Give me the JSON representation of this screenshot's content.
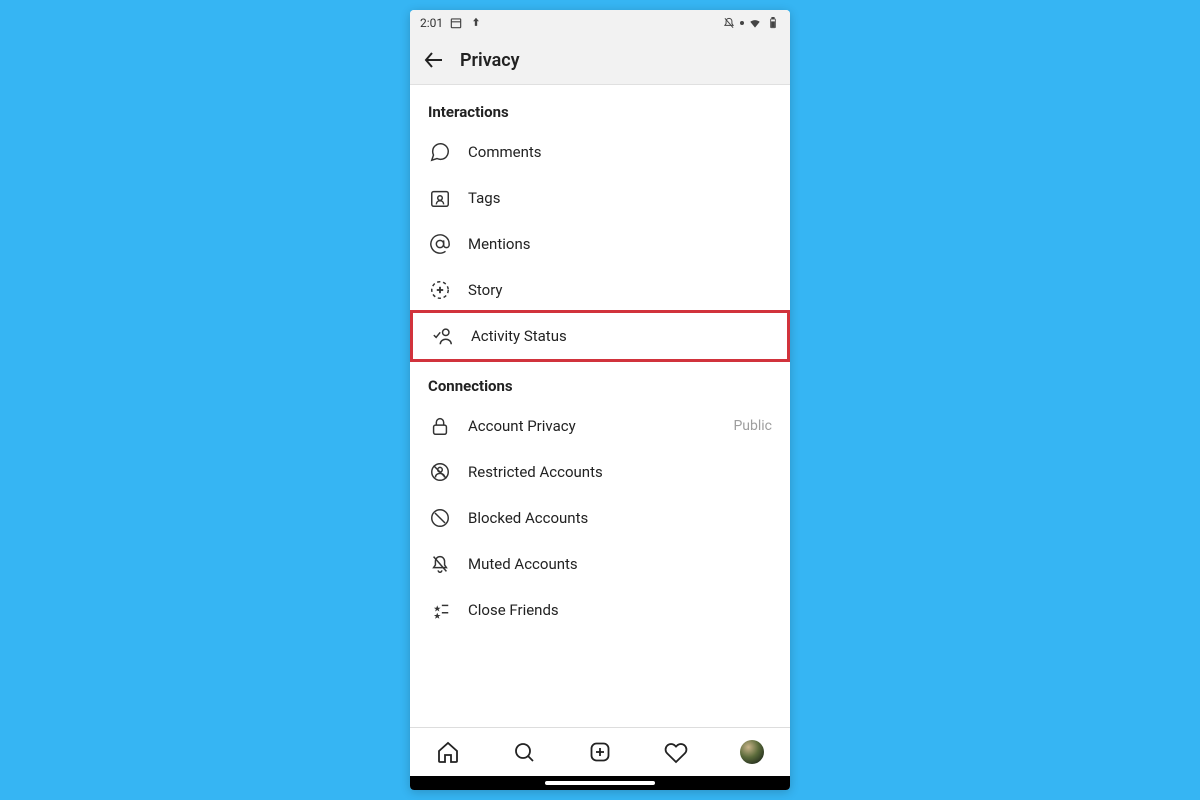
{
  "status": {
    "time": "2:01"
  },
  "header": {
    "title": "Privacy"
  },
  "sections": [
    {
      "title": "Interactions",
      "items": [
        {
          "label": "Comments"
        },
        {
          "label": "Tags"
        },
        {
          "label": "Mentions"
        },
        {
          "label": "Story"
        },
        {
          "label": "Activity Status",
          "highlighted": true
        }
      ]
    },
    {
      "title": "Connections",
      "items": [
        {
          "label": "Account Privacy",
          "value": "Public"
        },
        {
          "label": "Restricted Accounts"
        },
        {
          "label": "Blocked Accounts"
        },
        {
          "label": "Muted Accounts"
        },
        {
          "label": "Close Friends"
        }
      ]
    }
  ]
}
